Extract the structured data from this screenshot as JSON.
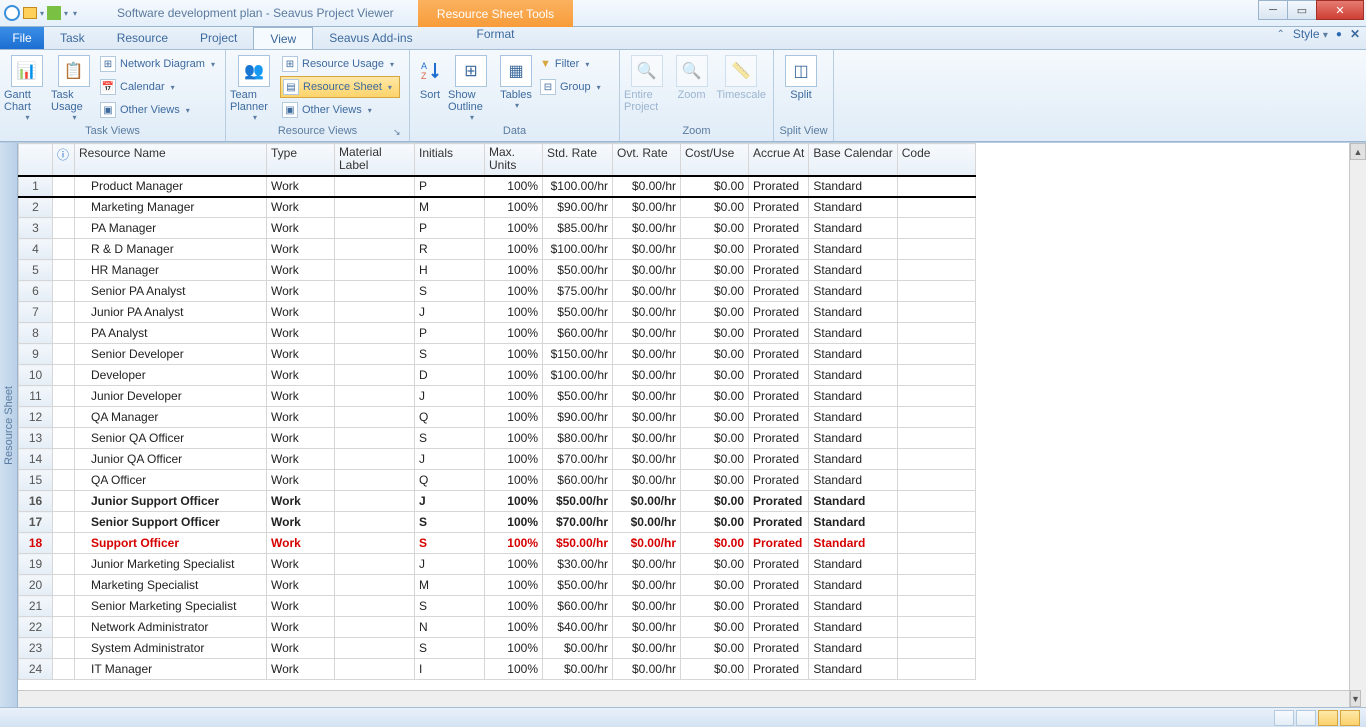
{
  "title": "Software development plan - Seavus Project Viewer",
  "context_tab": "Resource Sheet Tools",
  "menu": {
    "file": "File",
    "tabs": [
      "Task",
      "Resource",
      "Project",
      "View",
      "Seavus Add-ins"
    ],
    "active": "View",
    "format": "Format",
    "style": "Style"
  },
  "ribbon": {
    "groups": {
      "task_views": {
        "label": "Task Views",
        "gantt": "Gantt Chart",
        "usage": "Task Usage",
        "network": "Network Diagram",
        "calendar": "Calendar",
        "other": "Other Views"
      },
      "resource_views": {
        "label": "Resource Views",
        "team": "Team Planner",
        "usage": "Resource Usage",
        "sheet": "Resource Sheet",
        "other": "Other Views"
      },
      "data": {
        "label": "Data",
        "sort": "Sort",
        "outline": "Show Outline",
        "tables": "Tables",
        "filter": "Filter",
        "group": "Group"
      },
      "zoom": {
        "label": "Zoom",
        "entire": "Entire Project",
        "zoom": "Zoom",
        "timescale": "Timescale"
      },
      "split": {
        "label": "Split View",
        "split": "Split"
      }
    }
  },
  "sidebar": {
    "label": "Resource Sheet"
  },
  "columns": {
    "info": "",
    "name": "Resource Name",
    "type": "Type",
    "material": "Material Label",
    "initials": "Initials",
    "max": "Max. Units",
    "std": "Std. Rate",
    "ovt": "Ovt. Rate",
    "cost": "Cost/Use",
    "accrue": "Accrue At",
    "calendar": "Base Calendar",
    "code": "Code"
  },
  "rows": [
    {
      "n": 1,
      "name": "Product Manager",
      "type": "Work",
      "init": "P",
      "max": "100%",
      "std": "$100.00/hr",
      "ovt": "$0.00/hr",
      "cost": "$0.00",
      "acc": "Prorated",
      "cal": "Standard",
      "sel": true
    },
    {
      "n": 2,
      "name": "Marketing Manager",
      "type": "Work",
      "init": "M",
      "max": "100%",
      "std": "$90.00/hr",
      "ovt": "$0.00/hr",
      "cost": "$0.00",
      "acc": "Prorated",
      "cal": "Standard"
    },
    {
      "n": 3,
      "name": "PA Manager",
      "type": "Work",
      "init": "P",
      "max": "100%",
      "std": "$85.00/hr",
      "ovt": "$0.00/hr",
      "cost": "$0.00",
      "acc": "Prorated",
      "cal": "Standard"
    },
    {
      "n": 4,
      "name": "R & D Manager",
      "type": "Work",
      "init": "R",
      "max": "100%",
      "std": "$100.00/hr",
      "ovt": "$0.00/hr",
      "cost": "$0.00",
      "acc": "Prorated",
      "cal": "Standard"
    },
    {
      "n": 5,
      "name": "HR Manager",
      "type": "Work",
      "init": "H",
      "max": "100%",
      "std": "$50.00/hr",
      "ovt": "$0.00/hr",
      "cost": "$0.00",
      "acc": "Prorated",
      "cal": "Standard"
    },
    {
      "n": 6,
      "name": "Senior PA Analyst",
      "type": "Work",
      "init": "S",
      "max": "100%",
      "std": "$75.00/hr",
      "ovt": "$0.00/hr",
      "cost": "$0.00",
      "acc": "Prorated",
      "cal": "Standard"
    },
    {
      "n": 7,
      "name": "Junior PA Analyst",
      "type": "Work",
      "init": "J",
      "max": "100%",
      "std": "$50.00/hr",
      "ovt": "$0.00/hr",
      "cost": "$0.00",
      "acc": "Prorated",
      "cal": "Standard"
    },
    {
      "n": 8,
      "name": "PA Analyst",
      "type": "Work",
      "init": "P",
      "max": "100%",
      "std": "$60.00/hr",
      "ovt": "$0.00/hr",
      "cost": "$0.00",
      "acc": "Prorated",
      "cal": "Standard"
    },
    {
      "n": 9,
      "name": "Senior Developer",
      "type": "Work",
      "init": "S",
      "max": "100%",
      "std": "$150.00/hr",
      "ovt": "$0.00/hr",
      "cost": "$0.00",
      "acc": "Prorated",
      "cal": "Standard"
    },
    {
      "n": 10,
      "name": "Developer",
      "type": "Work",
      "init": "D",
      "max": "100%",
      "std": "$100.00/hr",
      "ovt": "$0.00/hr",
      "cost": "$0.00",
      "acc": "Prorated",
      "cal": "Standard"
    },
    {
      "n": 11,
      "name": "Junior Developer",
      "type": "Work",
      "init": "J",
      "max": "100%",
      "std": "$50.00/hr",
      "ovt": "$0.00/hr",
      "cost": "$0.00",
      "acc": "Prorated",
      "cal": "Standard"
    },
    {
      "n": 12,
      "name": "QA Manager",
      "type": "Work",
      "init": "Q",
      "max": "100%",
      "std": "$90.00/hr",
      "ovt": "$0.00/hr",
      "cost": "$0.00",
      "acc": "Prorated",
      "cal": "Standard"
    },
    {
      "n": 13,
      "name": "Senior QA Officer",
      "type": "Work",
      "init": "S",
      "max": "100%",
      "std": "$80.00/hr",
      "ovt": "$0.00/hr",
      "cost": "$0.00",
      "acc": "Prorated",
      "cal": "Standard"
    },
    {
      "n": 14,
      "name": "Junior QA Officer",
      "type": "Work",
      "init": "J",
      "max": "100%",
      "std": "$70.00/hr",
      "ovt": "$0.00/hr",
      "cost": "$0.00",
      "acc": "Prorated",
      "cal": "Standard"
    },
    {
      "n": 15,
      "name": "QA Officer",
      "type": "Work",
      "init": "Q",
      "max": "100%",
      "std": "$60.00/hr",
      "ovt": "$0.00/hr",
      "cost": "$0.00",
      "acc": "Prorated",
      "cal": "Standard"
    },
    {
      "n": 16,
      "name": "Junior Support Officer",
      "type": "Work",
      "init": "J",
      "max": "100%",
      "std": "$50.00/hr",
      "ovt": "$0.00/hr",
      "cost": "$0.00",
      "acc": "Prorated",
      "cal": "Standard",
      "bold": true
    },
    {
      "n": 17,
      "name": "Senior Support Officer",
      "type": "Work",
      "init": "S",
      "max": "100%",
      "std": "$70.00/hr",
      "ovt": "$0.00/hr",
      "cost": "$0.00",
      "acc": "Prorated",
      "cal": "Standard",
      "bold": true
    },
    {
      "n": 18,
      "name": "Support Officer",
      "type": "Work",
      "init": "S",
      "max": "100%",
      "std": "$50.00/hr",
      "ovt": "$0.00/hr",
      "cost": "$0.00",
      "acc": "Prorated",
      "cal": "Standard",
      "red": true
    },
    {
      "n": 19,
      "name": "Junior Marketing Specialist",
      "type": "Work",
      "init": "J",
      "max": "100%",
      "std": "$30.00/hr",
      "ovt": "$0.00/hr",
      "cost": "$0.00",
      "acc": "Prorated",
      "cal": "Standard"
    },
    {
      "n": 20,
      "name": "Marketing Specialist",
      "type": "Work",
      "init": "M",
      "max": "100%",
      "std": "$50.00/hr",
      "ovt": "$0.00/hr",
      "cost": "$0.00",
      "acc": "Prorated",
      "cal": "Standard"
    },
    {
      "n": 21,
      "name": "Senior Marketing Specialist",
      "type": "Work",
      "init": "S",
      "max": "100%",
      "std": "$60.00/hr",
      "ovt": "$0.00/hr",
      "cost": "$0.00",
      "acc": "Prorated",
      "cal": "Standard"
    },
    {
      "n": 22,
      "name": "Network Administrator",
      "type": "Work",
      "init": "N",
      "max": "100%",
      "std": "$40.00/hr",
      "ovt": "$0.00/hr",
      "cost": "$0.00",
      "acc": "Prorated",
      "cal": "Standard"
    },
    {
      "n": 23,
      "name": "System Administrator",
      "type": "Work",
      "init": "S",
      "max": "100%",
      "std": "$0.00/hr",
      "ovt": "$0.00/hr",
      "cost": "$0.00",
      "acc": "Prorated",
      "cal": "Standard"
    },
    {
      "n": 24,
      "name": "IT Manager",
      "type": "Work",
      "init": "I",
      "max": "100%",
      "std": "$0.00/hr",
      "ovt": "$0.00/hr",
      "cost": "$0.00",
      "acc": "Prorated",
      "cal": "Standard"
    }
  ]
}
